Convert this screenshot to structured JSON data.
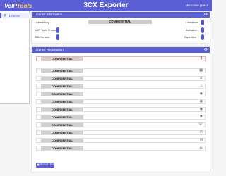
{
  "topbar": {
    "logo_vip": "VoIP",
    "logo_tools": "Tools",
    "title": "3CX Exporter",
    "welcome": "Welcome guest"
  },
  "sidebar": {
    "items": [
      {
        "label": "License",
        "icon": "key-icon"
      }
    ]
  },
  "license_info": {
    "title": "License Information",
    "license_key_label": "License Key",
    "license_key_value": "CONFIDENTIAL",
    "voip_tools_product_label": "VoIP Tools Product",
    "sdk_version_label": "SDK Version",
    "limitations_label": "Limitations",
    "activation_label": "Activation",
    "expiration_label": "Expiration"
  },
  "license_registration": {
    "title": "License Registration",
    "fields": [
      {
        "value": "CONFIDENTIAL",
        "icon": "key-icon"
      },
      {
        "value": "CONFIDENTIAL",
        "icon": "building-icon"
      },
      {
        "value": "CONFIDENTIAL",
        "icon": "person-icon"
      },
      {
        "value": "CONFIDENTIAL",
        "icon": "home-icon"
      },
      {
        "value": "CONFIDENTIAL",
        "icon": "location-icon"
      },
      {
        "value": "CONFIDENTIAL",
        "icon": "location-icon"
      },
      {
        "value": "CONFIDENTIAL",
        "icon": "location-icon"
      },
      {
        "value": "CONFIDENTIAL",
        "icon": "flag-icon"
      },
      {
        "value": "CONFIDENTIAL",
        "icon": "chat-icon"
      },
      {
        "value": "CONFIDENTIAL",
        "icon": "phone-icon"
      },
      {
        "value": "CONFIDENTIAL",
        "icon": "mail-icon"
      },
      {
        "value": "CONFIDENTIAL",
        "icon": "contacts-icon"
      }
    ],
    "register_label": "REGISTER"
  }
}
